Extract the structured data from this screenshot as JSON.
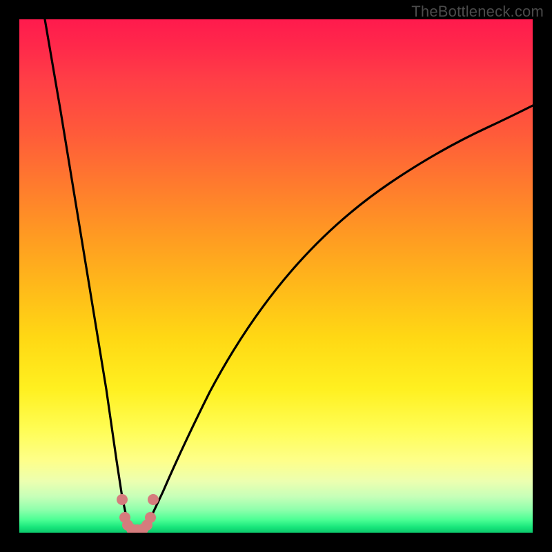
{
  "watermark": "TheBottleneck.com",
  "chart_data": {
    "type": "line",
    "title": "",
    "xlabel": "",
    "ylabel": "",
    "xlim": [
      0,
      100
    ],
    "ylim": [
      0,
      100
    ],
    "grid": false,
    "legend": false,
    "series": [
      {
        "name": "left-branch",
        "x": [
          5,
          8,
          11,
          14,
          17,
          19,
          20,
          21,
          21.5
        ],
        "values": [
          100,
          82,
          64,
          46,
          28,
          14,
          7,
          2.5,
          0.5
        ]
      },
      {
        "name": "right-branch",
        "x": [
          24.5,
          26,
          28,
          31,
          35,
          40,
          46,
          53,
          61,
          70,
          80,
          90,
          100
        ],
        "values": [
          0.5,
          3,
          8,
          17,
          28,
          40,
          51,
          60,
          67.5,
          73.5,
          78.5,
          82.5,
          86
        ]
      },
      {
        "name": "valley-marker",
        "x": [
          20,
          20.5,
          21,
          22,
          23,
          24,
          25,
          25.5,
          26
        ],
        "values": [
          6.5,
          3,
          1.5,
          0.7,
          0.5,
          0.7,
          1.5,
          3,
          6.5
        ]
      }
    ],
    "gradient_stops": [
      {
        "pos": 0.0,
        "color": "#ff1a4d"
      },
      {
        "pos": 0.2,
        "color": "#ff5a3a"
      },
      {
        "pos": 0.45,
        "color": "#ffb91a"
      },
      {
        "pos": 0.72,
        "color": "#fff020"
      },
      {
        "pos": 0.88,
        "color": "#ecffb0"
      },
      {
        "pos": 0.97,
        "color": "#4bff94"
      },
      {
        "pos": 1.0,
        "color": "#0dc86c"
      }
    ],
    "marker_color": "#d57c7d",
    "curve_color": "#000000"
  }
}
